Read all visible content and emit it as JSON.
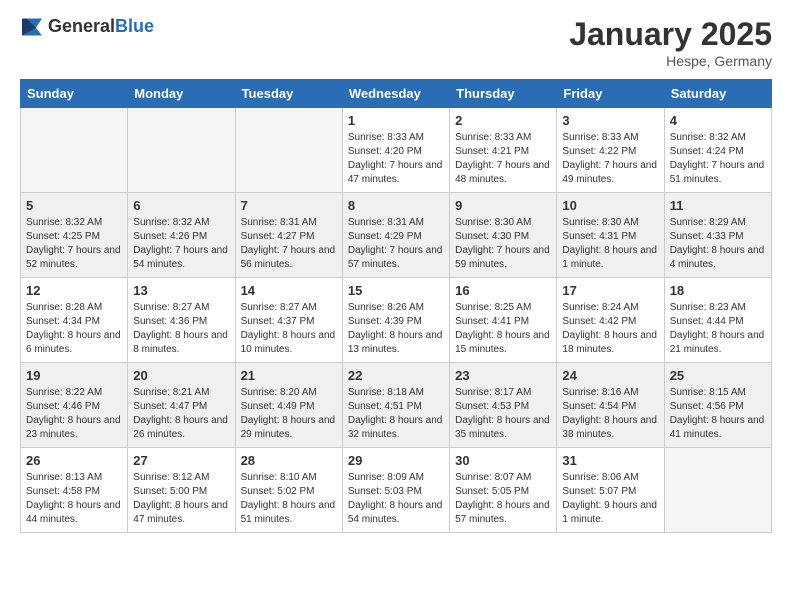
{
  "logo": {
    "text_general": "General",
    "text_blue": "Blue"
  },
  "title": "January 2025",
  "location": "Hespe, Germany",
  "days_of_week": [
    "Sunday",
    "Monday",
    "Tuesday",
    "Wednesday",
    "Thursday",
    "Friday",
    "Saturday"
  ],
  "weeks": [
    {
      "shaded": false,
      "days": [
        {
          "empty": true,
          "number": "",
          "info": ""
        },
        {
          "empty": true,
          "number": "",
          "info": ""
        },
        {
          "empty": true,
          "number": "",
          "info": ""
        },
        {
          "empty": false,
          "number": "1",
          "info": "Sunrise: 8:33 AM\nSunset: 4:20 PM\nDaylight: 7 hours and 47 minutes."
        },
        {
          "empty": false,
          "number": "2",
          "info": "Sunrise: 8:33 AM\nSunset: 4:21 PM\nDaylight: 7 hours and 48 minutes."
        },
        {
          "empty": false,
          "number": "3",
          "info": "Sunrise: 8:33 AM\nSunset: 4:22 PM\nDaylight: 7 hours and 49 minutes."
        },
        {
          "empty": false,
          "number": "4",
          "info": "Sunrise: 8:32 AM\nSunset: 4:24 PM\nDaylight: 7 hours and 51 minutes."
        }
      ]
    },
    {
      "shaded": true,
      "days": [
        {
          "empty": false,
          "number": "5",
          "info": "Sunrise: 8:32 AM\nSunset: 4:25 PM\nDaylight: 7 hours and 52 minutes."
        },
        {
          "empty": false,
          "number": "6",
          "info": "Sunrise: 8:32 AM\nSunset: 4:26 PM\nDaylight: 7 hours and 54 minutes."
        },
        {
          "empty": false,
          "number": "7",
          "info": "Sunrise: 8:31 AM\nSunset: 4:27 PM\nDaylight: 7 hours and 56 minutes."
        },
        {
          "empty": false,
          "number": "8",
          "info": "Sunrise: 8:31 AM\nSunset: 4:29 PM\nDaylight: 7 hours and 57 minutes."
        },
        {
          "empty": false,
          "number": "9",
          "info": "Sunrise: 8:30 AM\nSunset: 4:30 PM\nDaylight: 7 hours and 59 minutes."
        },
        {
          "empty": false,
          "number": "10",
          "info": "Sunrise: 8:30 AM\nSunset: 4:31 PM\nDaylight: 8 hours and 1 minute."
        },
        {
          "empty": false,
          "number": "11",
          "info": "Sunrise: 8:29 AM\nSunset: 4:33 PM\nDaylight: 8 hours and 4 minutes."
        }
      ]
    },
    {
      "shaded": false,
      "days": [
        {
          "empty": false,
          "number": "12",
          "info": "Sunrise: 8:28 AM\nSunset: 4:34 PM\nDaylight: 8 hours and 6 minutes."
        },
        {
          "empty": false,
          "number": "13",
          "info": "Sunrise: 8:27 AM\nSunset: 4:36 PM\nDaylight: 8 hours and 8 minutes."
        },
        {
          "empty": false,
          "number": "14",
          "info": "Sunrise: 8:27 AM\nSunset: 4:37 PM\nDaylight: 8 hours and 10 minutes."
        },
        {
          "empty": false,
          "number": "15",
          "info": "Sunrise: 8:26 AM\nSunset: 4:39 PM\nDaylight: 8 hours and 13 minutes."
        },
        {
          "empty": false,
          "number": "16",
          "info": "Sunrise: 8:25 AM\nSunset: 4:41 PM\nDaylight: 8 hours and 15 minutes."
        },
        {
          "empty": false,
          "number": "17",
          "info": "Sunrise: 8:24 AM\nSunset: 4:42 PM\nDaylight: 8 hours and 18 minutes."
        },
        {
          "empty": false,
          "number": "18",
          "info": "Sunrise: 8:23 AM\nSunset: 4:44 PM\nDaylight: 8 hours and 21 minutes."
        }
      ]
    },
    {
      "shaded": true,
      "days": [
        {
          "empty": false,
          "number": "19",
          "info": "Sunrise: 8:22 AM\nSunset: 4:46 PM\nDaylight: 8 hours and 23 minutes."
        },
        {
          "empty": false,
          "number": "20",
          "info": "Sunrise: 8:21 AM\nSunset: 4:47 PM\nDaylight: 8 hours and 26 minutes."
        },
        {
          "empty": false,
          "number": "21",
          "info": "Sunrise: 8:20 AM\nSunset: 4:49 PM\nDaylight: 8 hours and 29 minutes."
        },
        {
          "empty": false,
          "number": "22",
          "info": "Sunrise: 8:18 AM\nSunset: 4:51 PM\nDaylight: 8 hours and 32 minutes."
        },
        {
          "empty": false,
          "number": "23",
          "info": "Sunrise: 8:17 AM\nSunset: 4:53 PM\nDaylight: 8 hours and 35 minutes."
        },
        {
          "empty": false,
          "number": "24",
          "info": "Sunrise: 8:16 AM\nSunset: 4:54 PM\nDaylight: 8 hours and 38 minutes."
        },
        {
          "empty": false,
          "number": "25",
          "info": "Sunrise: 8:15 AM\nSunset: 4:56 PM\nDaylight: 8 hours and 41 minutes."
        }
      ]
    },
    {
      "shaded": false,
      "days": [
        {
          "empty": false,
          "number": "26",
          "info": "Sunrise: 8:13 AM\nSunset: 4:58 PM\nDaylight: 8 hours and 44 minutes."
        },
        {
          "empty": false,
          "number": "27",
          "info": "Sunrise: 8:12 AM\nSunset: 5:00 PM\nDaylight: 8 hours and 47 minutes."
        },
        {
          "empty": false,
          "number": "28",
          "info": "Sunrise: 8:10 AM\nSunset: 5:02 PM\nDaylight: 8 hours and 51 minutes."
        },
        {
          "empty": false,
          "number": "29",
          "info": "Sunrise: 8:09 AM\nSunset: 5:03 PM\nDaylight: 8 hours and 54 minutes."
        },
        {
          "empty": false,
          "number": "30",
          "info": "Sunrise: 8:07 AM\nSunset: 5:05 PM\nDaylight: 8 hours and 57 minutes."
        },
        {
          "empty": false,
          "number": "31",
          "info": "Sunrise: 8:06 AM\nSunset: 5:07 PM\nDaylight: 9 hours and 1 minute."
        },
        {
          "empty": true,
          "number": "",
          "info": ""
        }
      ]
    }
  ]
}
